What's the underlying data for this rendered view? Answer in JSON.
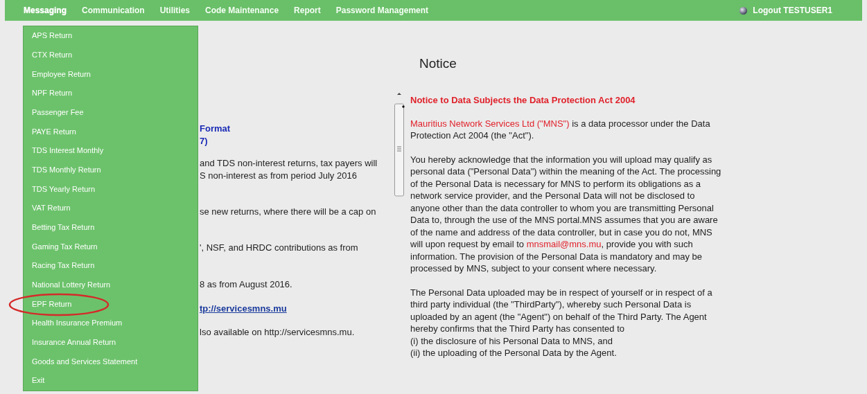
{
  "menu_bar": {
    "items": [
      {
        "label": "Messaging",
        "selected": true
      },
      {
        "label": "Communication",
        "selected": false
      },
      {
        "label": "Utilities",
        "selected": false
      },
      {
        "label": "Code Maintenance",
        "selected": false
      },
      {
        "label": "Report",
        "selected": false
      },
      {
        "label": "Password Management",
        "selected": false
      }
    ],
    "logout": "Logout TESTUSER1"
  },
  "dropdown": {
    "items": [
      {
        "label": "APS Return",
        "circled": false
      },
      {
        "label": "CTX Return",
        "circled": false
      },
      {
        "label": "Employee Return",
        "circled": false
      },
      {
        "label": "NPF Return",
        "circled": false
      },
      {
        "label": "Passenger Fee",
        "circled": false
      },
      {
        "label": "PAYE Return",
        "circled": false
      },
      {
        "label": "TDS Interest Monthly",
        "circled": false
      },
      {
        "label": "TDS Monthly Return",
        "circled": false
      },
      {
        "label": "TDS Yearly Return",
        "circled": false
      },
      {
        "label": "VAT Return",
        "circled": false
      },
      {
        "label": "Betting Tax Return",
        "circled": false
      },
      {
        "label": "Gaming Tax Return",
        "circled": false
      },
      {
        "label": "Racing Tax Return",
        "circled": false
      },
      {
        "label": "National Lottery Return",
        "circled": false
      },
      {
        "label": "EPF Return",
        "circled": true
      },
      {
        "label": "Health Insurance Premium",
        "circled": false
      },
      {
        "label": "Insurance Annual Return",
        "circled": false
      },
      {
        "label": "Goods and Services Statement",
        "circled": false
      },
      {
        "label": "Exit",
        "circled": false
      }
    ]
  },
  "left_content": [
    {
      "kind": "heading",
      "text": "Format"
    },
    {
      "kind": "heading",
      "text": "7)"
    },
    {
      "kind": "text",
      "text": "and TDS non-interest returns, tax payers will"
    },
    {
      "kind": "text",
      "text": "S non-interest as from period July 2016"
    },
    {
      "kind": "text",
      "text": "se new returns, where there will be a cap on"
    },
    {
      "kind": "text",
      "text": "', NSF, and HRDC contributions as from"
    },
    {
      "kind": "text",
      "text": "8 as from August 2016."
    },
    {
      "kind": "link",
      "text": "tp://servicesmns.mu"
    },
    {
      "kind": "text",
      "text": "lso available on http://servicesmns.mu."
    }
  ],
  "notice": {
    "title": "Notice",
    "heading": "Notice to Data Subjects the Data Protection Act 2004",
    "paragraphs": [
      [
        {
          "kind": "red",
          "text": "Mauritius Network Services Ltd (\"MNS\")"
        },
        {
          "kind": "plain",
          "text": " is a data processor under the Data Protection Act 2004 (the \"Act\")."
        }
      ],
      [
        {
          "kind": "plain",
          "text": "You hereby acknowledge that the information you will upload may qualify as personal data (\"Personal Data\") within the meaning of the Act. The processing of the Personal Data is necessary for MNS to perform its obligations as a network service provider, and the Personal Data will not be disclosed to anyone other than the data controller to whom you are transmitting Personal Data to, through the use of the MNS portal.MNS assumes that you are aware of the name and address of the data controller, but in case you do not, MNS will upon request by email to "
        },
        {
          "kind": "email",
          "text": "mnsmail@mns.mu"
        },
        {
          "kind": "plain",
          "text": ", provide you with such information. The provision of the Personal Data is mandatory and may be processed by MNS, subject to your consent where necessary."
        }
      ],
      [
        {
          "kind": "plain",
          "text": "The Personal Data uploaded may be in respect of yourself or in respect of a third party individual (the \"ThirdParty\"), whereby such Personal Data is uploaded by an agent (the \"Agent\") on behalf of the Third Party. The Agent hereby confirms that the Third Party has consented to\n(i) the disclosure of his Personal Data to MNS, and\n(ii) the uploading of the Personal Data by the Agent."
        }
      ]
    ]
  }
}
